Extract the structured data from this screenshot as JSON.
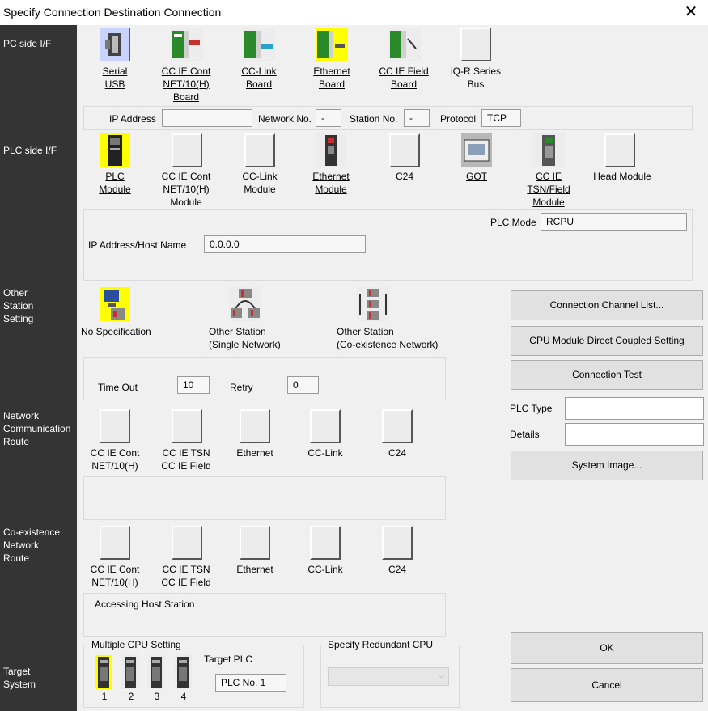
{
  "window": {
    "title": "Specify Connection Destination Connection"
  },
  "sidebar": {
    "pc_side": "PC side I/F",
    "plc_side": "PLC side I/F",
    "other_station": [
      "Other",
      "Station",
      "Setting"
    ],
    "network_route": [
      "Network",
      "Communication",
      "Route"
    ],
    "coexist_route": [
      "Co-existence",
      "Network",
      "Route"
    ],
    "target": [
      "Target",
      "System"
    ]
  },
  "pc_side": {
    "items": [
      {
        "label": [
          "Serial",
          "USB"
        ]
      },
      {
        "label": [
          "CC IE Cont",
          "NET/10(H)",
          "Board"
        ]
      },
      {
        "label": [
          "CC-Link",
          "Board"
        ]
      },
      {
        "label": [
          "Ethernet",
          "Board"
        ]
      },
      {
        "label": [
          "CC IE Field",
          "Board"
        ]
      },
      {
        "label": [
          "iQ-R Series",
          "Bus"
        ]
      }
    ],
    "ip_address_label": "IP Address",
    "ip_address_value": "",
    "network_no_label": "Network No.",
    "network_no_value": "-",
    "station_no_label": "Station No.",
    "station_no_value": "-",
    "protocol_label": "Protocol",
    "protocol_value": "TCP"
  },
  "plc_side": {
    "items": [
      {
        "label": [
          "PLC",
          "Module"
        ]
      },
      {
        "label": [
          "CC IE Cont",
          "NET/10(H)",
          "Module"
        ]
      },
      {
        "label": [
          "CC-Link",
          "Module"
        ]
      },
      {
        "label": [
          "Ethernet",
          "Module"
        ]
      },
      {
        "label": [
          "C24"
        ]
      },
      {
        "label": [
          "GOT"
        ]
      },
      {
        "label": [
          "CC IE",
          "TSN/Field",
          "Module"
        ]
      },
      {
        "label": [
          "Head Module"
        ]
      }
    ],
    "plc_mode_label": "PLC Mode",
    "plc_mode_value": "RCPU",
    "host_label": "IP Address/Host Name",
    "host_value": "0.0.0.0"
  },
  "other_station": {
    "items": [
      {
        "label": [
          "No Specification"
        ]
      },
      {
        "label": [
          "Other Station",
          "(Single Network)"
        ]
      },
      {
        "label": [
          "Other Station",
          "(Co-existence Network)"
        ]
      }
    ],
    "timeout_label": "Time Out",
    "timeout_value": "10",
    "retry_label": "Retry",
    "retry_value": "0"
  },
  "network_route": {
    "items": [
      {
        "label": [
          "CC IE Cont",
          "NET/10(H)"
        ]
      },
      {
        "label": [
          "CC IE TSN",
          "CC IE Field"
        ]
      },
      {
        "label": [
          "Ethernet"
        ]
      },
      {
        "label": [
          "CC-Link"
        ]
      },
      {
        "label": [
          "C24"
        ]
      }
    ]
  },
  "coexist_route": {
    "items": [
      {
        "label": [
          "CC IE Cont",
          "NET/10(H)"
        ]
      },
      {
        "label": [
          "CC IE TSN",
          "CC IE Field"
        ]
      },
      {
        "label": [
          "Ethernet"
        ]
      },
      {
        "label": [
          "CC-Link"
        ]
      },
      {
        "label": [
          "C24"
        ]
      }
    ],
    "accessing_text": "Accessing Host Station"
  },
  "target": {
    "multi_cpu_label": "Multiple CPU Setting",
    "cpu_numbers": [
      "1",
      "2",
      "3",
      "4"
    ],
    "target_plc_label": "Target PLC",
    "target_plc_value": "PLC No. 1",
    "redundant_label": "Specify Redundant CPU",
    "redundant_value": ""
  },
  "right_panel": {
    "channel_list": "Connection Channel List...",
    "cpu_direct": "CPU Module Direct Coupled Setting",
    "connection_test": "Connection Test",
    "plc_type_label": "PLC Type",
    "plc_type_value": "",
    "details_label": "Details",
    "details_value": "",
    "system_image": "System Image...",
    "ok": "OK",
    "cancel": "Cancel"
  },
  "colors": {
    "sidebar": "#343434",
    "selected": "#ffff00"
  }
}
